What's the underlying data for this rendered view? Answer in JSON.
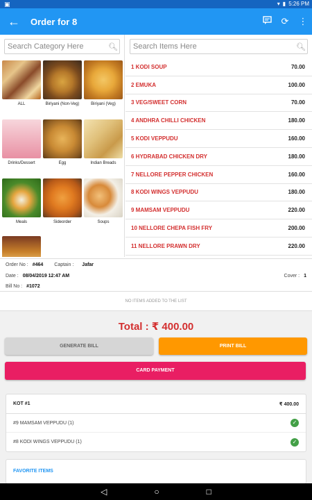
{
  "status": {
    "time": "5:26 PM",
    "left_icon": "android-icon"
  },
  "toolbar": {
    "title": "Order for 8"
  },
  "left": {
    "search_placeholder": "Search Category Here",
    "categories": [
      {
        "label": "ALL"
      },
      {
        "label": "Biriyani (Non-Veg)"
      },
      {
        "label": "Biriyani (Veg)"
      },
      {
        "label": "Drinks/Dessert"
      },
      {
        "label": "Egg"
      },
      {
        "label": "Indian Breads"
      },
      {
        "label": "Meals"
      },
      {
        "label": "Sideorder"
      },
      {
        "label": "Soups"
      },
      {
        "label": ""
      }
    ]
  },
  "right": {
    "search_placeholder": "Search Items Here",
    "items": [
      {
        "name": "1 KODI SOUP",
        "price": "70.00"
      },
      {
        "name": "2 EMUKA",
        "price": "100.00"
      },
      {
        "name": "3 VEG/SWEET CORN",
        "price": "70.00"
      },
      {
        "name": "4 ANDHRA CHILLI CHICKEN",
        "price": "180.00"
      },
      {
        "name": "5 KODI VEPPUDU",
        "price": "160.00"
      },
      {
        "name": "6 HYDRABAD CHICKEN DRY",
        "price": "180.00"
      },
      {
        "name": "7 NELLORE PEPPER CHICKEN",
        "price": "160.00"
      },
      {
        "name": "8 KODI WINGS VEPPUDU",
        "price": "180.00"
      },
      {
        "name": "9 MAMSAM VEPPUDU",
        "price": "220.00"
      },
      {
        "name": "10 NELLORE CHEPA FISH FRY",
        "price": "200.00"
      },
      {
        "name": "11 NELLORE PRAWN DRY",
        "price": "220.00"
      }
    ]
  },
  "order": {
    "order_no_label": "Order No :",
    "order_no": "#464",
    "captain_label": "Captain :",
    "captain": "Jafar",
    "date_label": "Date :",
    "date": "08/04/2019 12:47 AM",
    "cover_label": "Cover :",
    "cover": "1",
    "bill_no_label": "Bill No :",
    "bill_no": "#1072",
    "no_items": "NO ITEMS ADDED TO THE LIST",
    "total": "Total : ₹ 400.00"
  },
  "buttons": {
    "generate": "GENERATE BILL",
    "print": "PRINT BILL",
    "card": "CARD PAYMENT"
  },
  "kot": {
    "title": "KOT #1",
    "amount": "₹ 400.00",
    "lines": [
      {
        "text": "#9 MAMSAM VEPPUDU (1)"
      },
      {
        "text": "#8 KODI WINGS VEPPUDU (1)"
      }
    ]
  },
  "favorites": {
    "title": "FAVORITE ITEMS"
  },
  "colors": {
    "primary": "#2196f3",
    "accent_red": "#d32f2f",
    "print": "#ff9800",
    "card": "#e91e63",
    "check": "#43a047"
  }
}
